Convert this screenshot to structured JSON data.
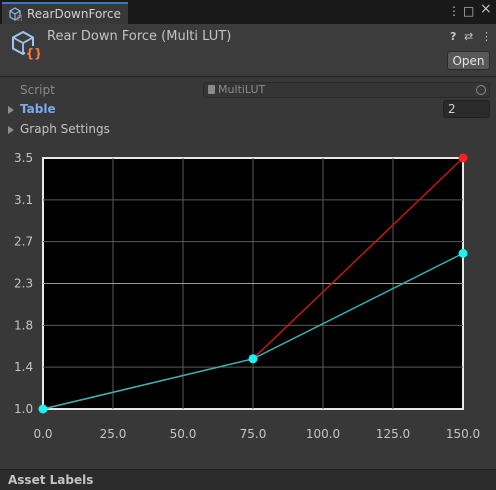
{
  "tab": {
    "title": "RearDownForce"
  },
  "window_buttons": {
    "menu": "⋮",
    "maximize": "□",
    "close": "×"
  },
  "header": {
    "title": "Rear Down Force (Multi LUT)",
    "open_label": "Open",
    "help_glyph": "?",
    "presets_glyph": "⇄",
    "more_glyph": "⋮"
  },
  "fields": {
    "script_label": "Script",
    "script_value": "MultiLUT",
    "table_label": "Table",
    "table_count": "2",
    "graph_settings_label": "Graph Settings"
  },
  "footer": {
    "label": "Asset Labels"
  },
  "colors": {
    "accent": "#3a79bb",
    "series1": "#c01818",
    "series2": "#30b4b4",
    "point_red": "#ff2020",
    "point_cyan": "#20f0f0"
  },
  "chart_data": {
    "type": "line",
    "xlim": [
      0,
      150
    ],
    "ylim": [
      1.0,
      3.5
    ],
    "x_ticks": [
      "0.0",
      "25.0",
      "50.0",
      "75.0",
      "100.0",
      "125.0",
      "150.0"
    ],
    "y_ticks": [
      "1.0",
      "1.4",
      "1.8",
      "2.3",
      "2.7",
      "3.1",
      "3.5"
    ],
    "grid": true,
    "series": [
      {
        "color": "#c01818",
        "point_color": "#ff2020",
        "points": [
          [
            0,
            1.0
          ],
          [
            75,
            1.5
          ],
          [
            150,
            3.5
          ]
        ]
      },
      {
        "color": "#30b4b4",
        "point_color": "#20f0f0",
        "points": [
          [
            0,
            1.0
          ],
          [
            75,
            1.5
          ],
          [
            150,
            2.55
          ]
        ]
      }
    ]
  }
}
